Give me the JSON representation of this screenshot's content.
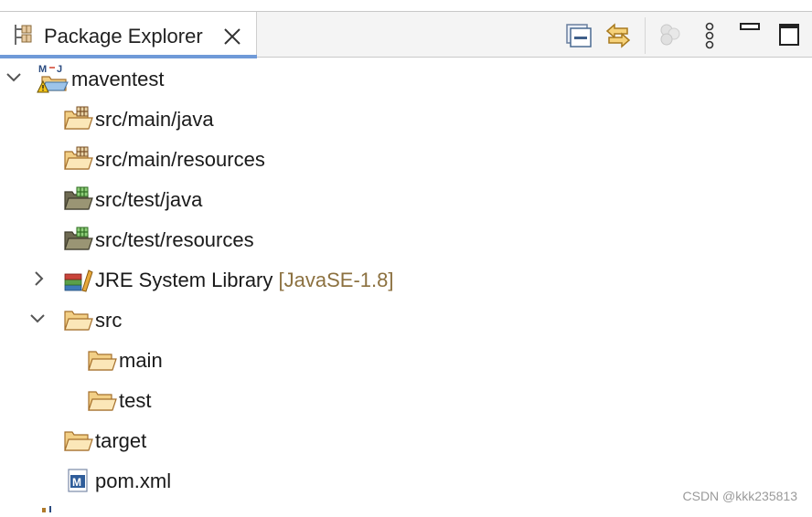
{
  "view": {
    "tab_title": "Package Explorer",
    "toolbar": [
      {
        "name": "collapse-all",
        "enabled": true
      },
      {
        "name": "link-with-editor",
        "enabled": true
      },
      {
        "name": "focus-on-active-task",
        "enabled": false
      },
      {
        "name": "view-menu",
        "enabled": true
      },
      {
        "name": "minimize",
        "enabled": true
      },
      {
        "name": "maximize",
        "enabled": true
      }
    ]
  },
  "tree": [
    {
      "label": "maventest",
      "icon": "maven-project-warning-icon",
      "expanded": true
    },
    {
      "label": "src/main/java",
      "icon": "source-folder-icon"
    },
    {
      "label": "src/main/resources",
      "icon": "source-folder-icon"
    },
    {
      "label": "src/test/java",
      "icon": "test-source-folder-icon"
    },
    {
      "label": "src/test/resources",
      "icon": "test-source-folder-icon"
    },
    {
      "label": "JRE System Library",
      "decoration": "[JavaSE-1.8]",
      "icon": "library-icon",
      "expanded": false
    },
    {
      "label": "src",
      "icon": "folder-icon",
      "expanded": true
    },
    {
      "label": "main",
      "icon": "folder-icon"
    },
    {
      "label": "test",
      "icon": "folder-icon"
    },
    {
      "label": "target",
      "icon": "folder-icon"
    },
    {
      "label": "pom.xml",
      "icon": "pom-file-icon"
    }
  ],
  "watermark": "CSDN @kkk235813",
  "colors": {
    "tab_underline": "#6f9ad8",
    "decoration": "#8c7140",
    "folder": "#f2cf86",
    "folder_stroke": "#a5702c"
  }
}
